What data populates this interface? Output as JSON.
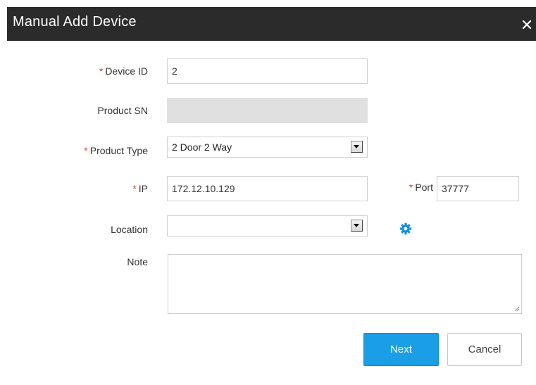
{
  "dialog": {
    "title": "Manual Add Device",
    "close_symbol": "×"
  },
  "form": {
    "required_marker": "*",
    "device_id": {
      "label": "Device ID",
      "value": "2",
      "required": true
    },
    "product_sn": {
      "label": "Product SN",
      "value": "",
      "disabled": true
    },
    "product_type": {
      "label": "Product Type",
      "value": "2 Door 2 Way",
      "required": true
    },
    "ip": {
      "label": "IP",
      "value": "172.12.10.129",
      "required": true
    },
    "port": {
      "label": "Port",
      "value": "37777",
      "required": true
    },
    "location": {
      "label": "Location",
      "value": ""
    },
    "note": {
      "label": "Note",
      "value": ""
    }
  },
  "buttons": {
    "next": "Next",
    "cancel": "Cancel"
  },
  "icons": {
    "close": "close-icon",
    "dropdown": "chevron-down-icon",
    "location_settings": "gear-icon",
    "resize": "resize-grip-icon"
  },
  "colors": {
    "titlebar": "#2b2b2b",
    "required": "#e23b3b",
    "primary_button": "#1a9ee6",
    "gear": "#1a8fd8",
    "disabled_field": "#e0e0e0"
  }
}
